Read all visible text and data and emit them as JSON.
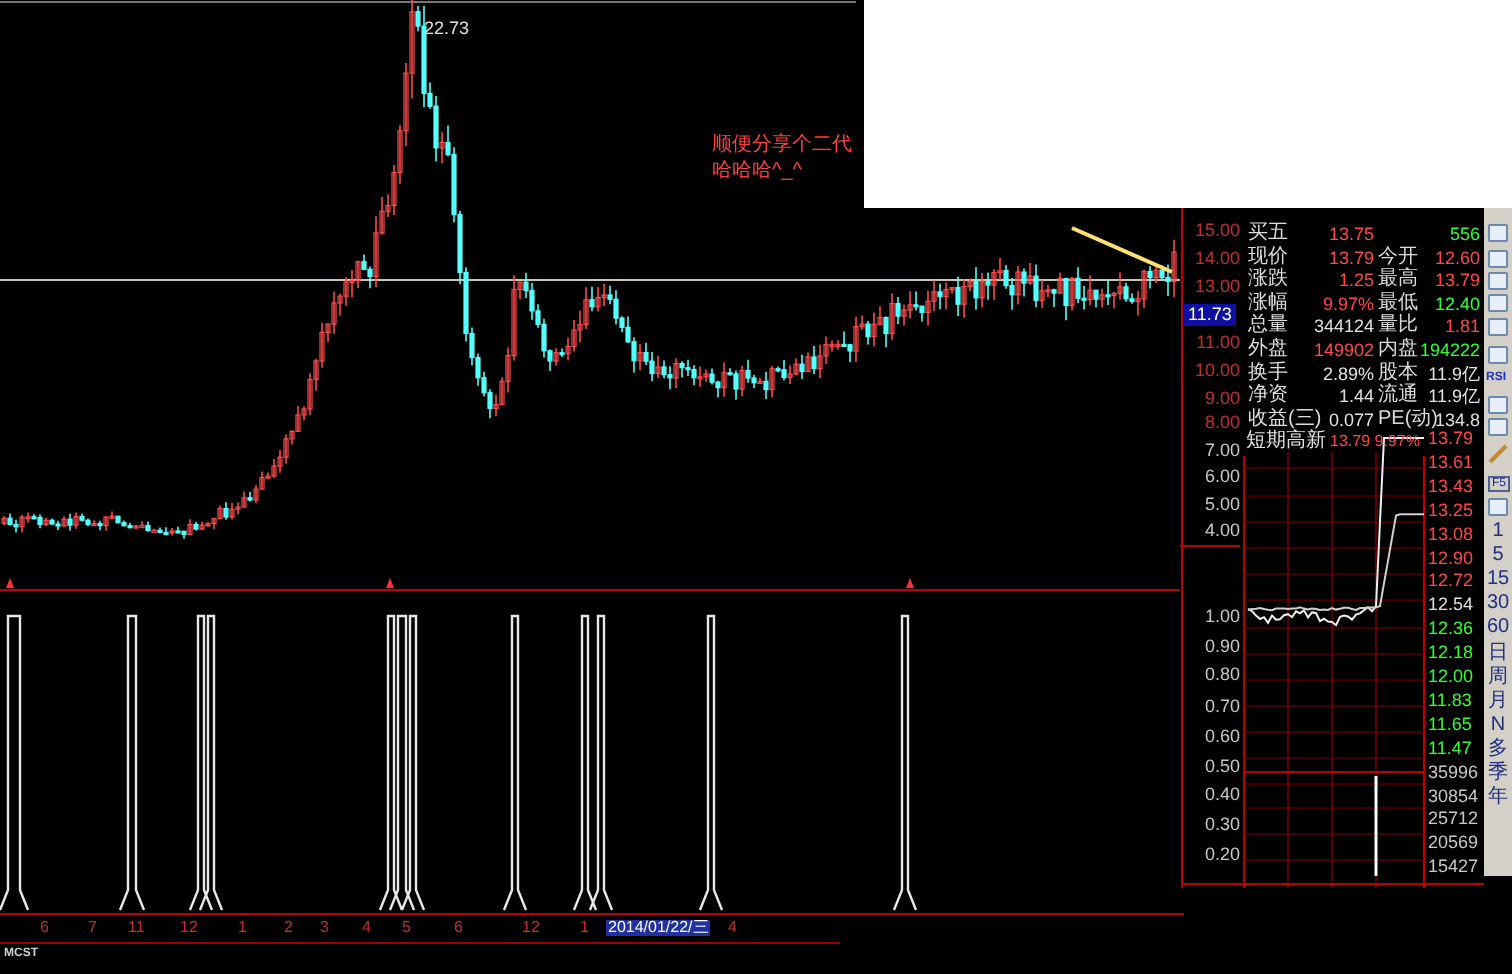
{
  "price_chart": {
    "peak_label": "22.73",
    "note_lines": [
      "顺便分享个二代",
      "哈哈哈^_^"
    ]
  },
  "price_axis": [
    "15.00",
    "14.00",
    "13.00",
    "11.00",
    "10.00",
    "9.00",
    "8.00"
  ],
  "current_price_tag": "11.73",
  "quote_rows": [
    {
      "label": "买五",
      "value": {
        "text": "13.75",
        "color": "#ff4848"
      },
      "value2": {
        "text": "556",
        "color": "#30ff30"
      }
    },
    {
      "label": "现价",
      "value": {
        "text": "13.79",
        "color": "#ff4848"
      },
      "label2": "今开",
      "value2": {
        "text": "12.60",
        "color": "#ff4848"
      }
    },
    {
      "label": "涨跌",
      "value": {
        "text": "1.25",
        "color": "#ff4848"
      },
      "label2": "最高",
      "value2": {
        "text": "13.79",
        "color": "#ff4848"
      }
    },
    {
      "label": "涨幅",
      "value": {
        "text": "9.97%",
        "color": "#ff4848"
      },
      "label2": "最低",
      "value2": {
        "text": "12.40",
        "color": "#30ff30"
      }
    },
    {
      "label": "总量",
      "value": {
        "text": "344124",
        "color": "#e0e0e0"
      },
      "label2": "量比",
      "value2": {
        "text": "1.81",
        "color": "#ff4848"
      }
    },
    {
      "label": "外盘",
      "value": {
        "text": "149902",
        "color": "#ff4848"
      },
      "label2": "内盘",
      "value2": {
        "text": "194222",
        "color": "#30ff30"
      }
    },
    {
      "label": "换手",
      "value": {
        "text": "2.89%",
        "color": "#e0e0e0"
      },
      "label2": "股本",
      "value2": {
        "text": "11.9亿",
        "color": "#e0e0e0"
      }
    },
    {
      "label": "净资",
      "value": {
        "text": "1.44",
        "color": "#e0e0e0"
      },
      "label2": "流通",
      "value2": {
        "text": "11.9亿",
        "color": "#e0e0e0"
      }
    },
    {
      "label": "收益(三)",
      "value": {
        "text": "0.077",
        "color": "#e0e0e0"
      },
      "label2": "PE(动)",
      "value2": {
        "text": "134.8",
        "color": "#e0e0e0"
      }
    }
  ],
  "intraday": {
    "name": "短期高新",
    "price_change": "13.79 9.97%",
    "left_axis": [
      "7.00",
      "6.00",
      "5.00",
      "4.00",
      "1.00",
      "0.90",
      "0.80",
      "0.70",
      "0.60",
      "0.50",
      "0.40",
      "0.30",
      "0.20"
    ],
    "right_axis": [
      "13.79",
      "13.61",
      "13.43",
      "13.25",
      "13.08",
      "12.90",
      "12.72",
      "12.54",
      "12.36",
      "12.18",
      "12.00",
      "11.83",
      "11.65",
      "11.47",
      "35996",
      "30854",
      "25712",
      "20569",
      "15427"
    ]
  },
  "toolbar": {
    "rsi_label": "RSI",
    "f5_label": "F5",
    "periods": [
      "1",
      "5",
      "15",
      "30",
      "60",
      "日",
      "周",
      "月",
      "N",
      "多",
      "季",
      "年"
    ]
  },
  "date_axis": [
    {
      "label": "6",
      "selected": false
    },
    {
      "label": "7",
      "selected": false
    },
    {
      "label": "11",
      "selected": false
    },
    {
      "label": "12",
      "selected": false
    },
    {
      "label": "1",
      "selected": false
    },
    {
      "label": "2",
      "selected": false
    },
    {
      "label": "3",
      "selected": false
    },
    {
      "label": "4",
      "selected": false
    },
    {
      "label": "5",
      "selected": false
    },
    {
      "label": "6",
      "selected": false
    },
    {
      "label": "12",
      "selected": false
    },
    {
      "label": "1",
      "selected": false
    },
    {
      "label": "2014/01/22/三",
      "selected": true
    },
    {
      "label": "4",
      "selected": false
    }
  ],
  "indicator_name": "MCST"
}
